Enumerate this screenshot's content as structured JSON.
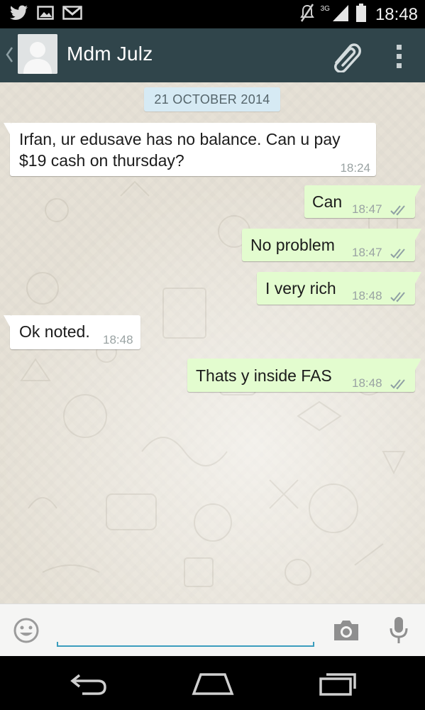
{
  "status_bar": {
    "network_label": "3G",
    "time": "18:48",
    "left_icons": [
      "twitter-icon",
      "gallery-icon",
      "gmail-icon"
    ],
    "right_icons": [
      "mute-icon",
      "signal-icon",
      "battery-icon"
    ]
  },
  "header": {
    "contact_name": "Mdm Julz",
    "icons": [
      "back-chevron-icon",
      "avatar-placeholder",
      "paperclip-icon",
      "overflow-menu-icon"
    ]
  },
  "chat": {
    "date_label": "21 OCTOBER 2014",
    "messages": [
      {
        "direction": "incoming",
        "lines": [
          "Irfan, ur edusave has no balance. Can u pay",
          "$19 cash on thursday?"
        ],
        "time": "18:24"
      },
      {
        "direction": "outgoing",
        "text": "Can",
        "time": "18:47",
        "status": "read"
      },
      {
        "direction": "outgoing",
        "text": "No problem",
        "time": "18:47",
        "status": "read"
      },
      {
        "direction": "outgoing",
        "text": "I very rich",
        "time": "18:48",
        "status": "read"
      },
      {
        "direction": "incoming",
        "text": "Ok noted.",
        "time": "18:48"
      },
      {
        "direction": "outgoing",
        "text": "Thats y inside FAS",
        "time": "18:48",
        "status": "read"
      }
    ]
  },
  "input_bar": {
    "value": "",
    "placeholder": "",
    "icons": [
      "emoji-icon",
      "camera-icon",
      "microphone-icon"
    ]
  },
  "nav_bar": {
    "icons": [
      "back-icon",
      "home-icon",
      "recents-icon"
    ]
  },
  "colors": {
    "header_bg": "#30454b",
    "chat_bg": "#e6e1d6",
    "incoming_bubble": "#ffffff",
    "outgoing_bubble": "#e3fccf",
    "date_chip": "#d6eaf4",
    "read_ticks": "#8fa0a4",
    "input_accent": "#3b9dbd"
  }
}
